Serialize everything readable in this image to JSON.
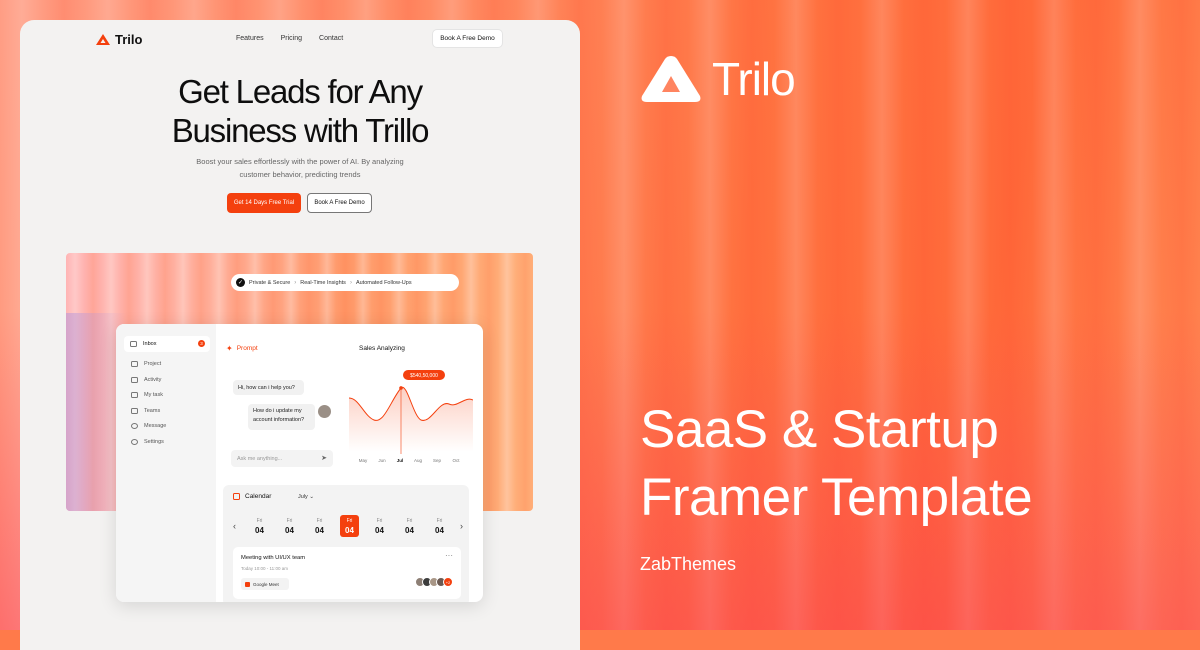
{
  "nav": {
    "logo": "Trilo",
    "links": [
      "Features",
      "Pricing",
      "Contact"
    ],
    "cta": "Book A Free Demo"
  },
  "hero": {
    "title_line1": "Get Leads for Any",
    "title_line2": "Business with Trillo",
    "sub_line1": "Boost your sales effortlessly with the power of AI. By analyzing",
    "sub_line2": "customer behavior, predicting trends",
    "primary_btn": "Get 14 Days Free Trial",
    "secondary_btn": "Book A Free Demo"
  },
  "features_pill": [
    "Private & Secure",
    "Real-Time Insights",
    "Automated Follow-Ups"
  ],
  "dashboard": {
    "sidebar": {
      "inbox": "Inbox",
      "inbox_badge": "3",
      "items": [
        "Project",
        "Activity",
        "My task",
        "Teams",
        "Message",
        "Settings"
      ]
    },
    "prompt": {
      "title": "Prompt",
      "bot_msg": "Hi, how can i help you?",
      "user_msg_line1": "How do i update my",
      "user_msg_line2": "account information?",
      "input_placeholder": "Ask me anything..."
    },
    "sales": {
      "title": "Sales Analyzing",
      "tooltip": "$540,50,000",
      "months": [
        "May",
        "Jun",
        "Jul",
        "Aug",
        "Sep",
        "Oct"
      ]
    },
    "calendar": {
      "title": "Calendar",
      "month": "July",
      "days": [
        {
          "dow": "Fri",
          "num": "04"
        },
        {
          "dow": "Fri",
          "num": "04"
        },
        {
          "dow": "Fri",
          "num": "04"
        },
        {
          "dow": "Fri",
          "num": "04"
        },
        {
          "dow": "Fri",
          "num": "04"
        },
        {
          "dow": "Fri",
          "num": "04"
        },
        {
          "dow": "Fri",
          "num": "04"
        }
      ],
      "active_index": 3,
      "meeting": {
        "title": "Meeting with UI/UX team",
        "time": "Today 10:00 - 11:00 am",
        "tag": "Google Meet",
        "more": "+2"
      }
    }
  },
  "right": {
    "brand": "Trilo",
    "headline_line1": "SaaS & Startup",
    "headline_line2": "Framer Template",
    "author": "ZabThemes"
  },
  "colors": {
    "accent": "#f4400e",
    "card": "#f3f2f1"
  }
}
